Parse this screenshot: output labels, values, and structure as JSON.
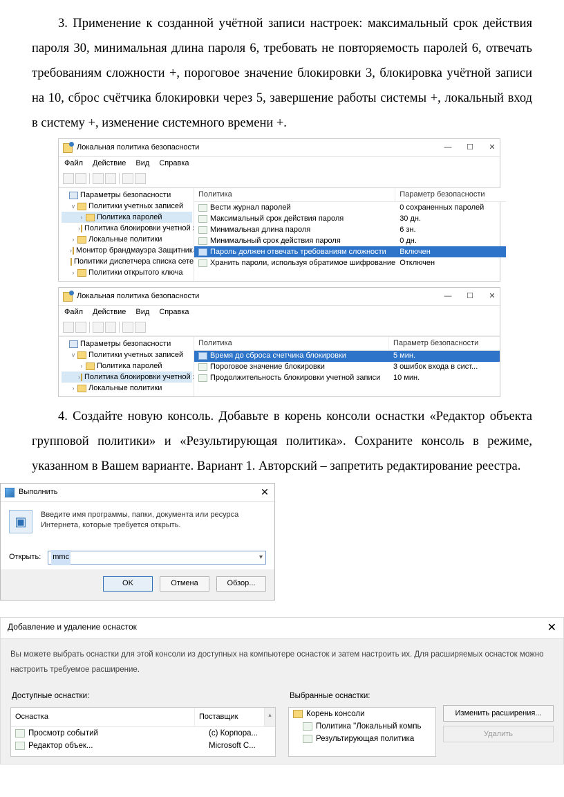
{
  "para3": "3. Применение к созданной учётной записи настроек: максимальный срок действия пароля 30, минимальная длина пароля 6, требовать не повторяемость паролей 6, отвечать требованиям сложности +, пороговое значение блокировки 3, блокировка учётной записи на 10, сброс счётчика блокировки через 5, завершение работы системы +, локальный вход в систему +, изменение системного времени +.",
  "para4": "4. Создайте новую консоль. Добавьте в корень консоли оснастки «Редактор объекта групповой политики» и «Результирующая политика». Сохраните консоль в режиме, указанном в Вашем варианте.  Вариант 1. Авторский – запретить редактирование реестра.",
  "secpol": {
    "title": "Локальная политика безопасности",
    "menu": [
      "Файл",
      "Действие",
      "Вид",
      "Справка"
    ],
    "captions": {
      "min": "—",
      "max": "☐",
      "close": "✕"
    },
    "tree1": [
      {
        "label": "Параметры безопасности",
        "indent": 0,
        "twist": "",
        "icon": "shield"
      },
      {
        "label": "Политики учетных записей",
        "indent": 1,
        "twist": "v",
        "icon": "fldr"
      },
      {
        "label": "Политика паролей",
        "indent": 2,
        "twist": "›",
        "icon": "fldr",
        "selected": true
      },
      {
        "label": "Политика блокировки учетной з",
        "indent": 2,
        "twist": "›",
        "icon": "fldr"
      },
      {
        "label": "Локальные политики",
        "indent": 1,
        "twist": "›",
        "icon": "fldr"
      },
      {
        "label": "Монитор брандмауэра Защитника",
        "indent": 1,
        "twist": "›",
        "icon": "fldr"
      },
      {
        "label": "Политики диспетчера списка сетей",
        "indent": 1,
        "twist": "",
        "icon": "fldr"
      },
      {
        "label": "Политики открытого ключа",
        "indent": 1,
        "twist": "›",
        "icon": "fldr"
      }
    ],
    "cols": {
      "policy": "Политика",
      "setting": "Параметр безопасности"
    },
    "rows1": [
      {
        "p": "Вести журнал паролей",
        "v": "0 сохраненных паролей"
      },
      {
        "p": "Максимальный срок действия пароля",
        "v": "30 дн."
      },
      {
        "p": "Минимальная длина пароля",
        "v": "6 зн."
      },
      {
        "p": "Минимальный срок действия пароля",
        "v": "0 дн."
      },
      {
        "p": "Пароль должен отвечать требованиям сложности",
        "v": "Включен",
        "selected": true
      },
      {
        "p": "Хранить пароли, используя обратимое шифрование",
        "v": "Отключен"
      }
    ],
    "tree2": [
      {
        "label": "Параметры безопасности",
        "indent": 0,
        "twist": "",
        "icon": "shield"
      },
      {
        "label": "Политики учетных записей",
        "indent": 1,
        "twist": "v",
        "icon": "fldr"
      },
      {
        "label": "Политика паролей",
        "indent": 2,
        "twist": "›",
        "icon": "fldr"
      },
      {
        "label": "Политика блокировки учетной з",
        "indent": 2,
        "twist": "›",
        "icon": "fldr",
        "selected": true
      },
      {
        "label": "Локальные политики",
        "indent": 1,
        "twist": "›",
        "icon": "fldr"
      }
    ],
    "rows2": [
      {
        "p": "Время до сброса счетчика блокировки",
        "v": "5 мин.",
        "selected": true
      },
      {
        "p": "Пороговое значение блокировки",
        "v": "3 ошибок входа в сист..."
      },
      {
        "p": "Продолжительность блокировки учетной записи",
        "v": "10 мин."
      }
    ]
  },
  "run": {
    "title": "Выполнить",
    "desc": "Введите имя программы, папки, документа или ресурса Интернета, которые требуется открыть.",
    "open_label": "Открыть:",
    "value": "mmc",
    "buttons": {
      "ok": "OK",
      "cancel": "Отмена",
      "browse": "Обзор..."
    }
  },
  "snap": {
    "title": "Добавление и удаление оснасток",
    "desc": "Вы можете выбрать оснастки для этой консоли из доступных на компьютере оснасток и затем настроить их. Для расширяемых оснасток можно настроить требуемое расширение.",
    "available_label": "Доступные оснастки:",
    "selected_label": "Выбранные оснастки:",
    "headers": {
      "snapin": "Оснастка",
      "vendor": "Поставщик"
    },
    "available": [
      {
        "name": "Просмотр событий",
        "vendor": "(c) Корпора..."
      },
      {
        "name": "Редактор объек...",
        "vendor": "Microsoft C..."
      }
    ],
    "selected": [
      {
        "name": "Корень консоли",
        "root": true
      },
      {
        "name": "Политика \"Локальный компь"
      },
      {
        "name": "Результирующая политика"
      }
    ],
    "buttons": {
      "edit_ext": "Изменить расширения...",
      "remove": "Удалить"
    }
  }
}
